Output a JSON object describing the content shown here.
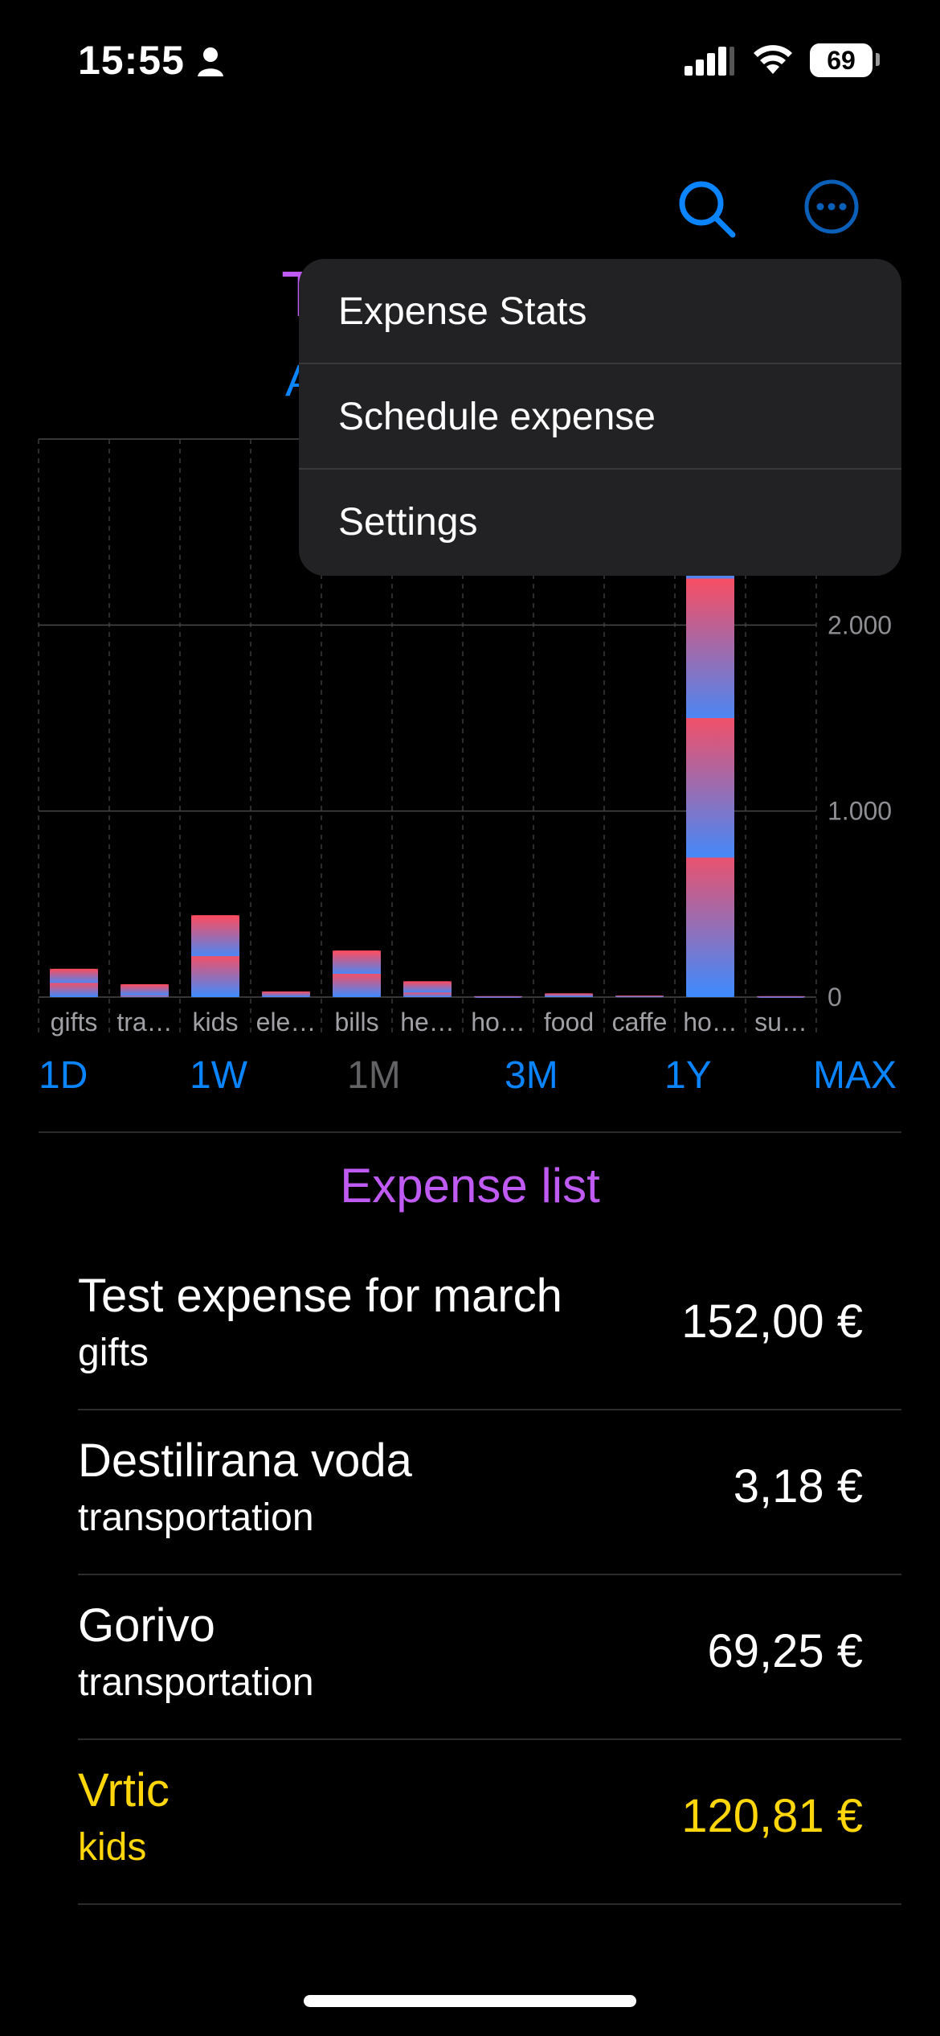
{
  "status": {
    "time": "15:55",
    "battery": "69"
  },
  "header": {
    "title_peek": "T",
    "subtitle_peek": "A"
  },
  "menu": {
    "items": [
      "Expense Stats",
      "Schedule expense",
      "Settings"
    ]
  },
  "chart_data": {
    "type": "bar",
    "categories": [
      "gifts",
      "tra…",
      "kids",
      "ele…",
      "bills",
      "he…",
      "ho…",
      "food",
      "caffe",
      "ho…",
      "su…"
    ],
    "values": [
      152,
      69,
      440,
      30,
      250,
      85,
      5,
      20,
      8,
      3000,
      5
    ],
    "y_ticks": [
      "0",
      "1.000",
      "2.000"
    ],
    "ylim": [
      0,
      3000
    ],
    "colors": {
      "red": "#ff4b5c",
      "blue": "#3d8bff"
    }
  },
  "range": [
    "1D",
    "1W",
    "1M",
    "3M",
    "1Y",
    "MAX"
  ],
  "range_selected": "1M",
  "list": {
    "title": "Expense list",
    "items": [
      {
        "name": "Test expense for march",
        "category": "gifts",
        "amount": "152,00 €"
      },
      {
        "name": "Destilirana voda",
        "category": "transportation",
        "amount": "3,18 €"
      },
      {
        "name": "Gorivo",
        "category": "transportation",
        "amount": "69,25 €"
      },
      {
        "name": "Vrtic",
        "category": "kids",
        "amount": "120,81 €"
      }
    ]
  }
}
